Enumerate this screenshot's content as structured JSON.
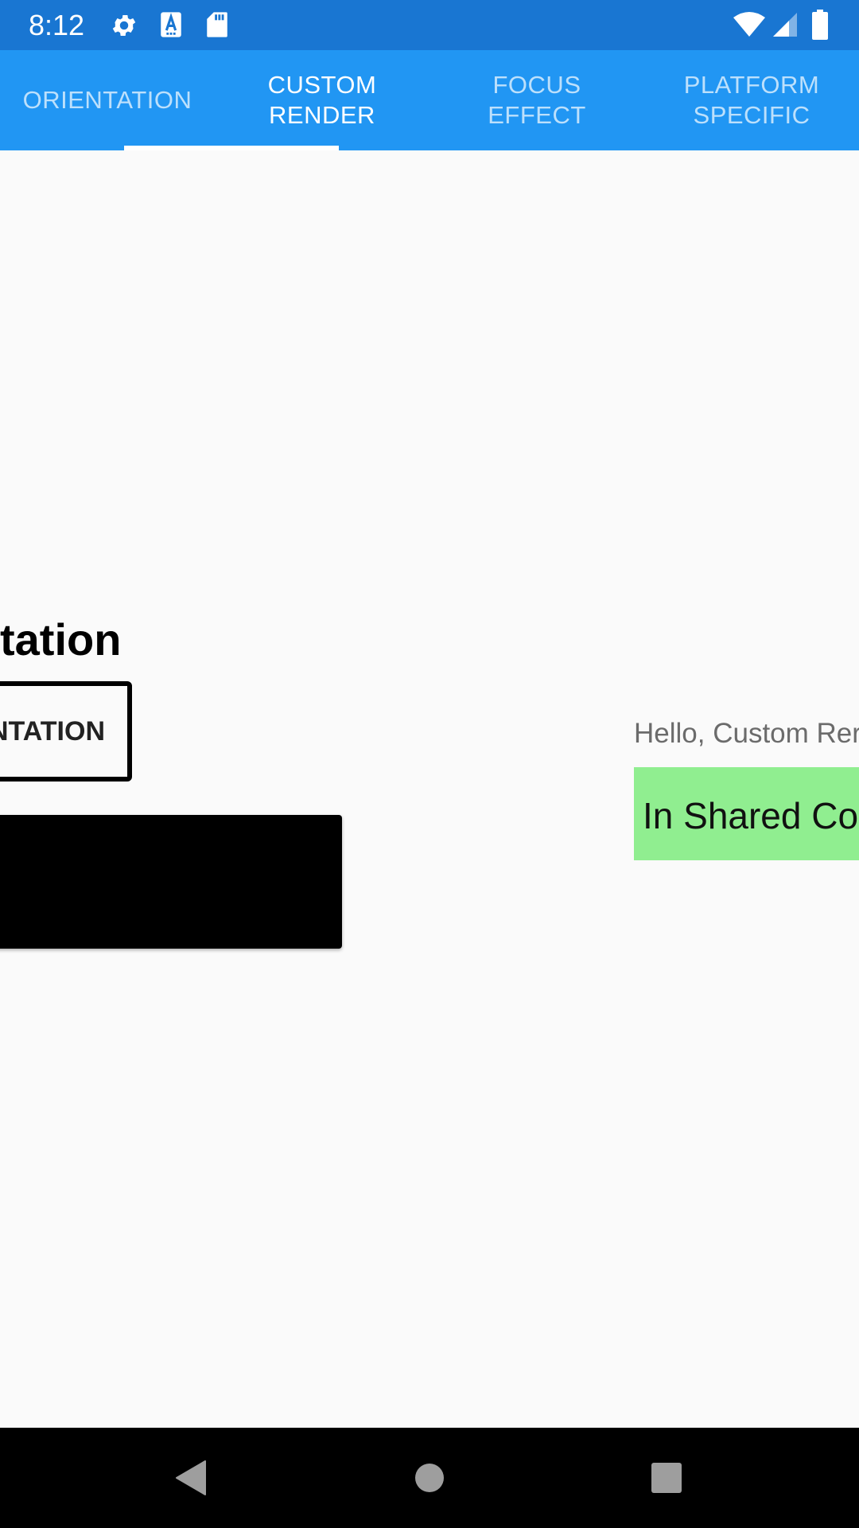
{
  "status_bar": {
    "time": "8:12",
    "icons": [
      "gear-icon",
      "a-notification-icon",
      "sd-card-icon",
      "wifi-icon",
      "signal-icon",
      "battery-icon"
    ],
    "background": "#1976d2"
  },
  "tabs": [
    {
      "label": "ORIENTATION",
      "active": false
    },
    {
      "label": "CUSTOM\nRENDER",
      "active": true
    },
    {
      "label": "FOCUS\nEFFECT",
      "active": false
    },
    {
      "label": "PLATFORM\nSPECIFIC",
      "active": false
    }
  ],
  "tab_bar_color": "#2196f3",
  "content": {
    "heading": "tation",
    "outline_button_label": "NTATION",
    "hello_label": "Hello, Custom Rer",
    "shared_code_text": "In Shared Co",
    "shared_box_color": "#90ee90"
  },
  "nav_bar": {
    "icons": [
      "back-icon",
      "home-icon",
      "recents-icon"
    ]
  }
}
